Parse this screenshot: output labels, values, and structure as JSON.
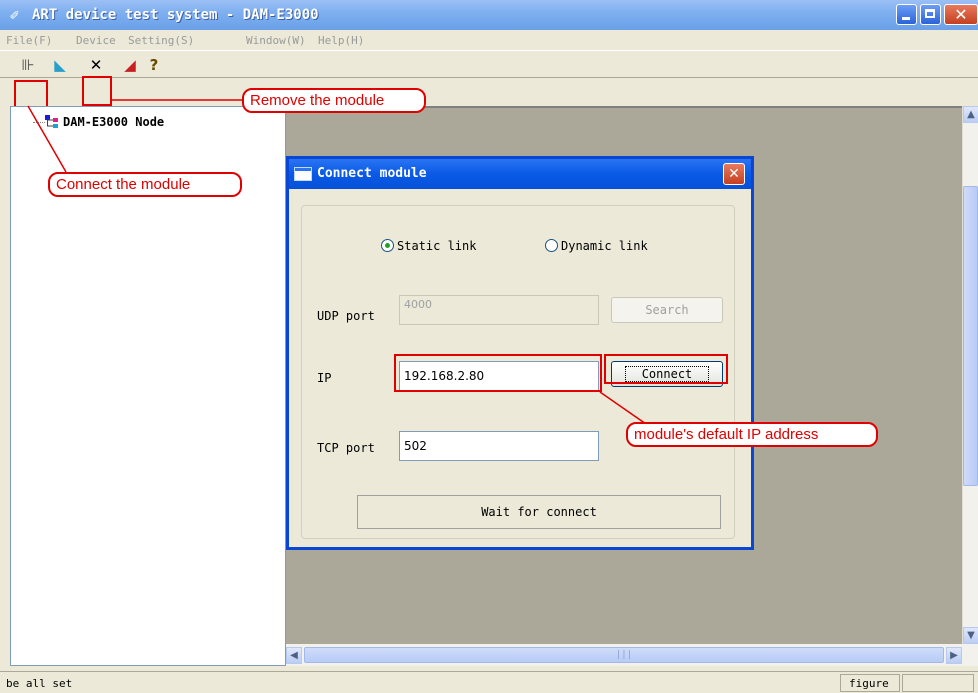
{
  "window": {
    "title": "ART device test system - DAM-E3000",
    "app_icon": "pen-icon"
  },
  "menu": [
    {
      "label": "File(F)"
    },
    {
      "label": "Device"
    },
    {
      "label": "Setting(S)"
    },
    {
      "label": "Window(W)"
    },
    {
      "label": "Help(H)"
    }
  ],
  "toolbar": {
    "items": [
      {
        "name": "connect-module-icon",
        "glyph": "⊪"
      },
      {
        "name": "device-icon",
        "glyph": "◣"
      },
      {
        "name": "remove-module-icon",
        "glyph": "✕"
      },
      {
        "name": "settings-icon",
        "glyph": "◢"
      },
      {
        "name": "help-icon",
        "glyph": "?"
      }
    ]
  },
  "tree": {
    "root_label": "DAM-E3000 Node"
  },
  "dialog": {
    "title": "Connect module",
    "close_glyph": "✕",
    "static_link_label": "Static link",
    "dynamic_link_label": "Dynamic link",
    "static_selected": true,
    "udp_label": "UDP port",
    "udp_value": "4000",
    "search_label": "Search",
    "ip_label": "IP",
    "ip_value": "192.168.2.80",
    "connect_label": "Connect",
    "tcp_label": "TCP port",
    "tcp_value": "502",
    "status_text": "Wait for connect"
  },
  "annotations": {
    "remove": "Remove the module",
    "connect": "Connect the module",
    "default_ip": "module's default IP address"
  },
  "statusbar": {
    "left": "be all set",
    "panel": "figure"
  },
  "colors": {
    "annotation_red": "#e00000",
    "title_blue": "#0a46d4"
  }
}
